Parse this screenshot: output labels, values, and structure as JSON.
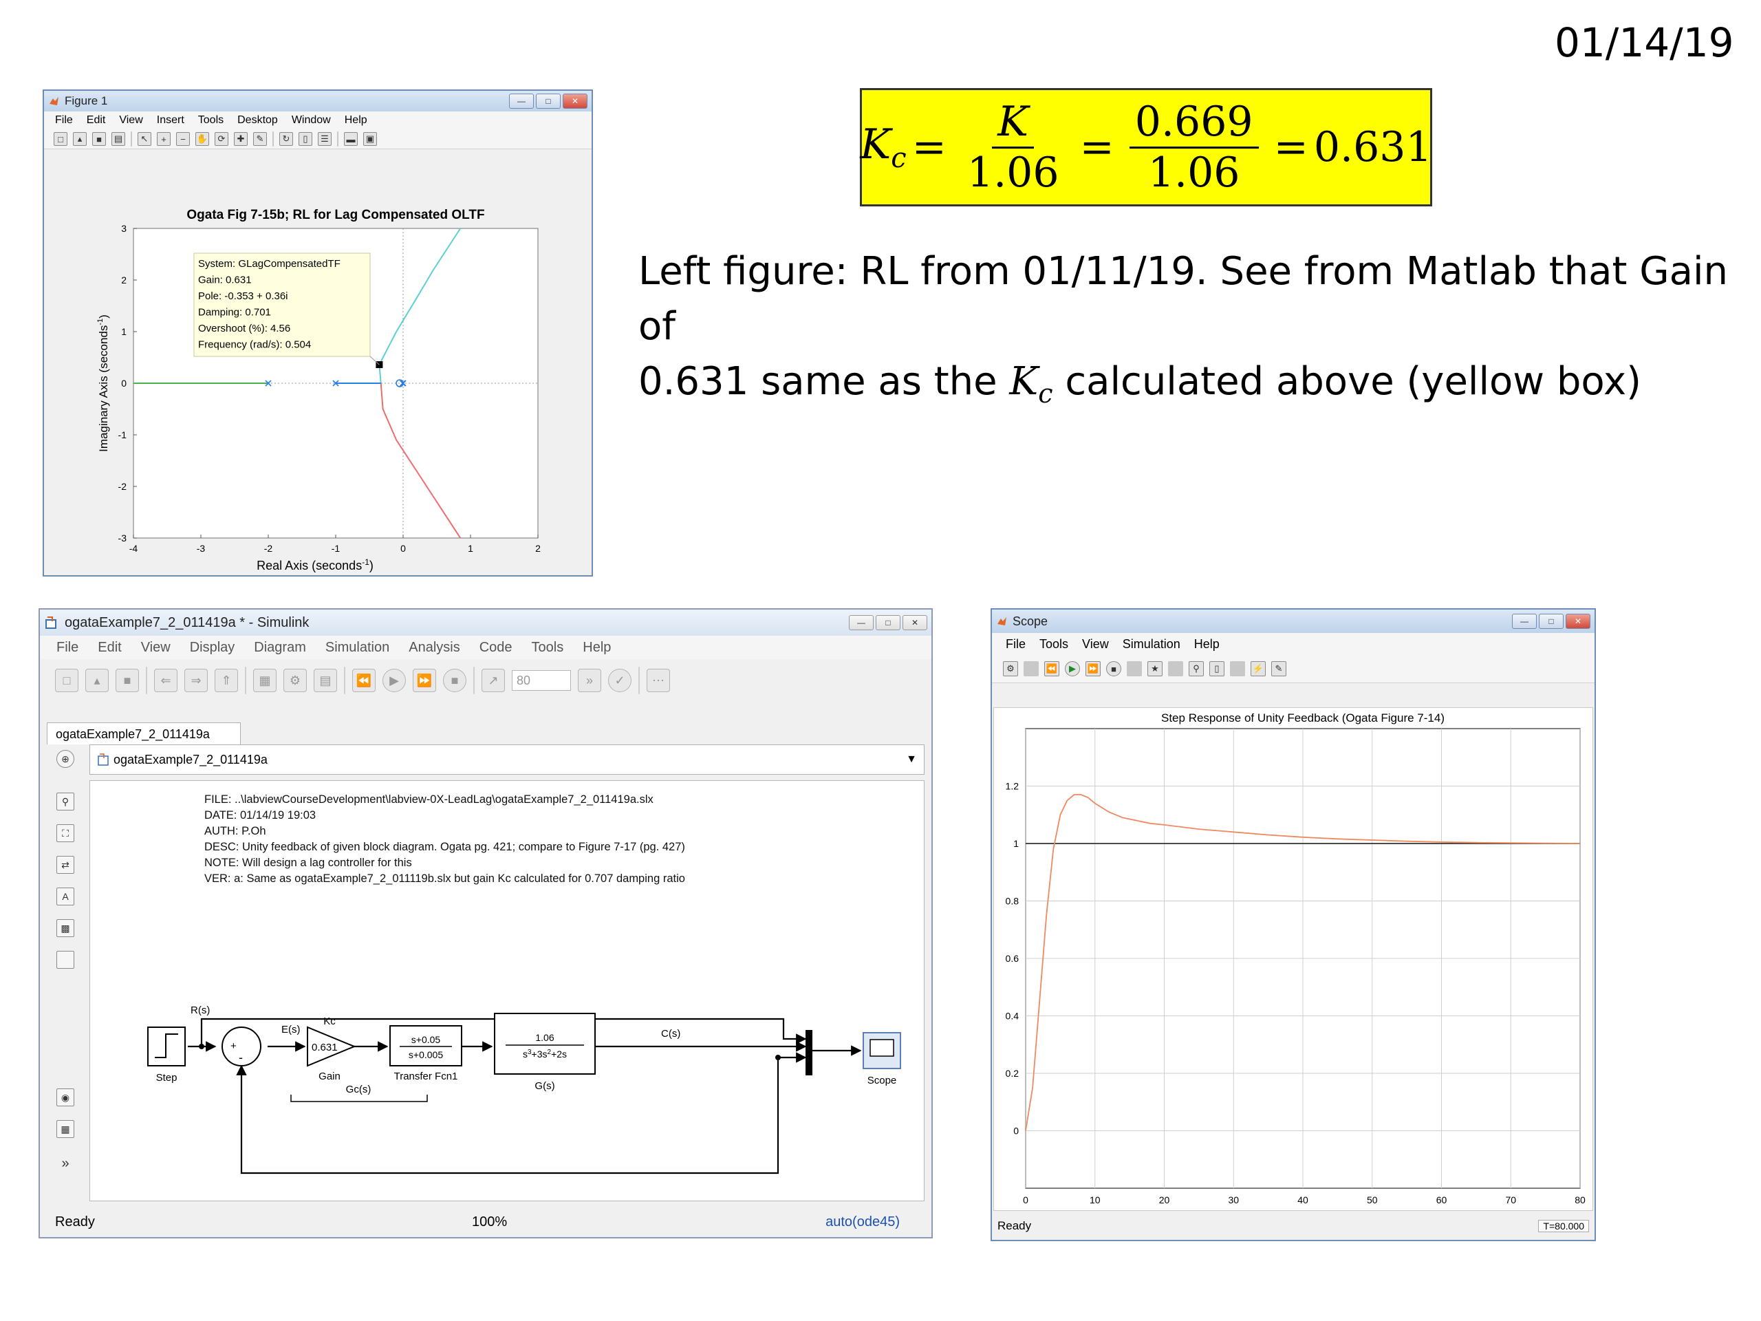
{
  "slide": {
    "date": "01/14/19",
    "equation": {
      "lhs": "K",
      "lhs_sub": "c",
      "frac1_num": "K",
      "frac1_den": "1.06",
      "frac2_num": "0.669",
      "frac2_den": "1.06",
      "result": "0.631"
    },
    "note": {
      "line1": "Left figure: RL from 01/11/19.  See from Matlab that Gain of",
      "line2_pre": "0.631 same as the ",
      "line2_k": "K",
      "line2_sub": "c",
      "line2_post": " calculated above (yellow box)"
    }
  },
  "figure_window": {
    "title": "Figure 1",
    "menu": [
      "File",
      "Edit",
      "View",
      "Insert",
      "Tools",
      "Desktop",
      "Window",
      "Help"
    ],
    "chart_data": {
      "type": "root-locus",
      "title": "Ogata Fig 7-15b; RL for Lag Compensated OLTF",
      "xlabel": "Real Axis (seconds",
      "xlabel_sup": "-1",
      "xlabel_end": ")",
      "ylabel": "Imaginary Axis (seconds",
      "ylabel_sup": "-1",
      "ylabel_end": ")",
      "xlim": [
        -4,
        2
      ],
      "ylim": [
        -3,
        3
      ],
      "x_ticks": [
        "-4",
        "-3",
        "-2",
        "-1",
        "0",
        "1",
        "2"
      ],
      "y_ticks": [
        "3",
        "2",
        "1",
        "0",
        "-1",
        "-2",
        "-3"
      ],
      "poles": [
        [
          -2,
          0
        ],
        [
          -1,
          0
        ],
        [
          0,
          0
        ],
        [
          -0.005,
          0
        ]
      ],
      "zeros": [
        [
          -0.05,
          0
        ]
      ],
      "branches": [
        {
          "color": "#5dcfd6",
          "points": [
            [
              -0.33,
              0
            ],
            [
              -0.353,
              0.36
            ],
            [
              -0.1,
              1
            ],
            [
              0.2,
              1.65
            ],
            [
              0.45,
              2.2
            ],
            [
              0.85,
              3
            ]
          ]
        },
        {
          "color": "#f06b6b",
          "points": [
            [
              -0.33,
              0
            ],
            [
              -0.3,
              -0.5
            ],
            [
              -0.1,
              -1.1
            ],
            [
              0.2,
              -1.7
            ],
            [
              0.5,
              -2.3
            ],
            [
              0.85,
              -3
            ]
          ]
        },
        {
          "color": "#4caf50",
          "points": [
            [
              -4,
              0
            ],
            [
              -2,
              0
            ]
          ]
        },
        {
          "color": "#2a7de1",
          "points": [
            [
              -1,
              0
            ],
            [
              -0.33,
              0
            ]
          ]
        }
      ],
      "selected_point": [
        -0.353,
        0.36
      ],
      "datatip": {
        "system": "System: GLagCompensatedTF",
        "gain": "Gain: 0.631",
        "pole": "Pole: -0.353 + 0.36i",
        "damping": "Damping: 0.701",
        "overshoot": "Overshoot (%): 4.56",
        "frequency": "Frequency (rad/s): 0.504"
      }
    }
  },
  "simulink_window": {
    "title": "ogataExample7_2_011419a * - Simulink",
    "menu": [
      "File",
      "Edit",
      "View",
      "Display",
      "Diagram",
      "Simulation",
      "Analysis",
      "Code",
      "Tools",
      "Help"
    ],
    "stop_time": "80",
    "tab": "ogataExample7_2_011419a",
    "address": "ogataExample7_2_011419a",
    "annotation": [
      "FILE: ..\\labviewCourseDevelopment\\labview-0X-LeadLag\\ogataExample7_2_011419a.slx",
      "DATE: 01/14/19 19:03",
      "AUTH: P.Oh",
      "DESC: Unity feedback of given block diagram.  Ogata pg. 421; compare to Figure 7-17 (pg. 427)",
      "NOTE: Will design a lag controller for this",
      "VER: a: Same as ogataExample7_2_011119b.slx but gain Kc calculated for 0.707 damping ratio"
    ],
    "diagram": {
      "step_label": "Step",
      "r_label": "R(s)",
      "e_label": "E(s)",
      "kc_label": "Kc",
      "gain_value": "0.631",
      "gain_label": "Gain",
      "tf1_num": "s+0.05",
      "tf1_den": "s+0.005",
      "tf1_label": "Transfer Fcn1",
      "gc_label": "Gc(s)",
      "tf2_num": "1.06",
      "tf2_den_a": "s",
      "tf2_den_b": "3",
      "tf2_den_c": "+3s",
      "tf2_den_d": "2",
      "tf2_den_e": "+2s",
      "gs_label": "G(s)",
      "c_label": "C(s)",
      "scope_label": "Scope",
      "plus": "+",
      "minus": "-"
    },
    "status": {
      "left": "Ready",
      "zoom": "100%",
      "solver": "auto(ode45)"
    }
  },
  "scope_window": {
    "title": "Scope",
    "menu": [
      "File",
      "Tools",
      "View",
      "Simulation",
      "Help"
    ],
    "chart_data": {
      "type": "line",
      "title": "Step Response of Unity Feedback (Ogata Figure 7-14)",
      "xlim": [
        0,
        80
      ],
      "ylim": [
        -0.2,
        1.4
      ],
      "x_ticks": [
        "0",
        "10",
        "20",
        "30",
        "40",
        "50",
        "60",
        "70",
        "80"
      ],
      "y_ticks": [
        "1.2",
        "1",
        "0.8",
        "0.6",
        "0.4",
        "0.2",
        "0"
      ],
      "series": [
        {
          "color": "#f08860",
          "x": [
            0,
            1,
            2,
            3,
            4,
            5,
            6,
            7,
            8,
            9,
            10,
            12,
            14,
            16,
            18,
            20,
            25,
            30,
            35,
            40,
            45,
            50,
            55,
            60,
            65,
            70,
            75,
            80
          ],
          "y": [
            0,
            0.15,
            0.45,
            0.75,
            0.98,
            1.1,
            1.15,
            1.17,
            1.17,
            1.16,
            1.14,
            1.11,
            1.09,
            1.08,
            1.07,
            1.065,
            1.05,
            1.04,
            1.03,
            1.022,
            1.016,
            1.012,
            1.008,
            1.005,
            1.003,
            1.002,
            1.001,
            1.0
          ]
        },
        {
          "color": "#333333",
          "x": [
            0,
            80
          ],
          "y": [
            1,
            1
          ]
        }
      ]
    },
    "status": {
      "left": "Ready",
      "time": "T=80.000"
    }
  }
}
